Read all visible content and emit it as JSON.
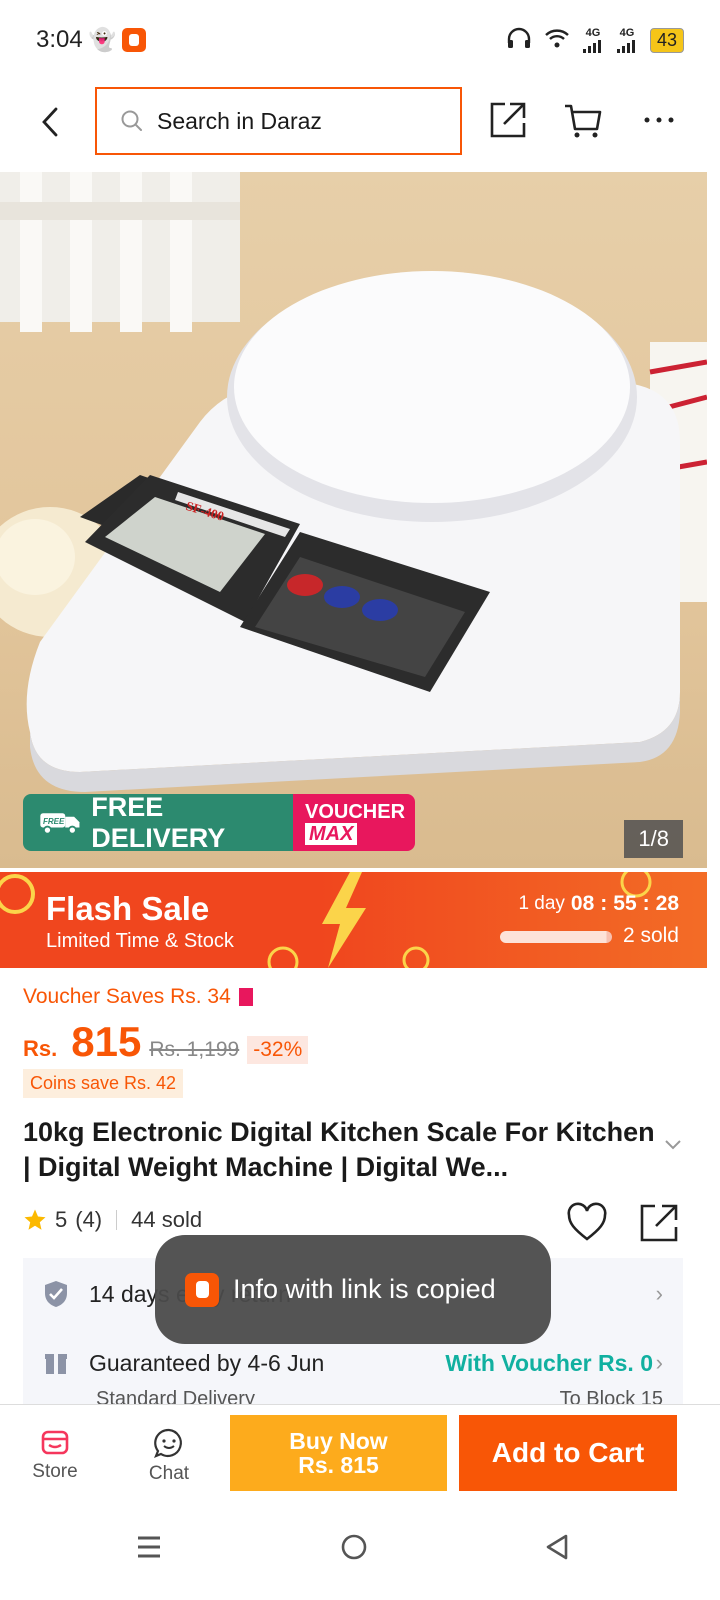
{
  "status_bar": {
    "time": "3:04",
    "battery": "43",
    "network1": "4G",
    "network2": "4G"
  },
  "header": {
    "search_placeholder": "Search in Daraz"
  },
  "gallery": {
    "badge_free": "FREE DELIVERY",
    "badge_free_small": "FREE",
    "badge_voucher_line1": "VOUCHER",
    "badge_voucher_line2": "MAX",
    "counter": "1/8",
    "scale_model": "SF-400"
  },
  "flash_sale": {
    "title": "FlaϞ Sale",
    "title_display": "Flash Sale",
    "subtitle": "Limited Time & Stock",
    "days": "1 day",
    "hours": "08",
    "minutes": "55",
    "seconds": "28",
    "sold": "2 sold",
    "progress": 0.95
  },
  "price": {
    "voucher_saves": "Voucher Saves Rs. 34",
    "currency": "Rs.",
    "value": "815",
    "old": "Rs. 1,199",
    "discount": "-32%",
    "coins": "Coins save Rs. 42"
  },
  "product": {
    "title": "10kg Electronic Digital Kitchen Scale For Kitchen | Digital Weight Machine | Digital We...",
    "rating": "5",
    "reviews": "(4)",
    "sold": "44 sold"
  },
  "delivery": {
    "return_text": "14 days easy return",
    "guaranteed": "Guaranteed by 4-6 Jun",
    "voucher": "With Voucher Rs. 0",
    "standard": "Standard Delivery",
    "to": "To Block 15"
  },
  "toast": {
    "text": "Info with link is copied"
  },
  "bottom_bar": {
    "store": "Store",
    "chat": "Chat",
    "buy_now_line1": "Buy Now",
    "buy_now_line2": "Rs. 815",
    "add_to_cart": "Add to Cart"
  },
  "colors": {
    "accent": "#f85606",
    "flash": "#f0461e",
    "buy_now": "#fdab1c",
    "voucher": "#e8175d",
    "delivery_green": "#2c8a6f",
    "teal": "#11b0a0"
  }
}
